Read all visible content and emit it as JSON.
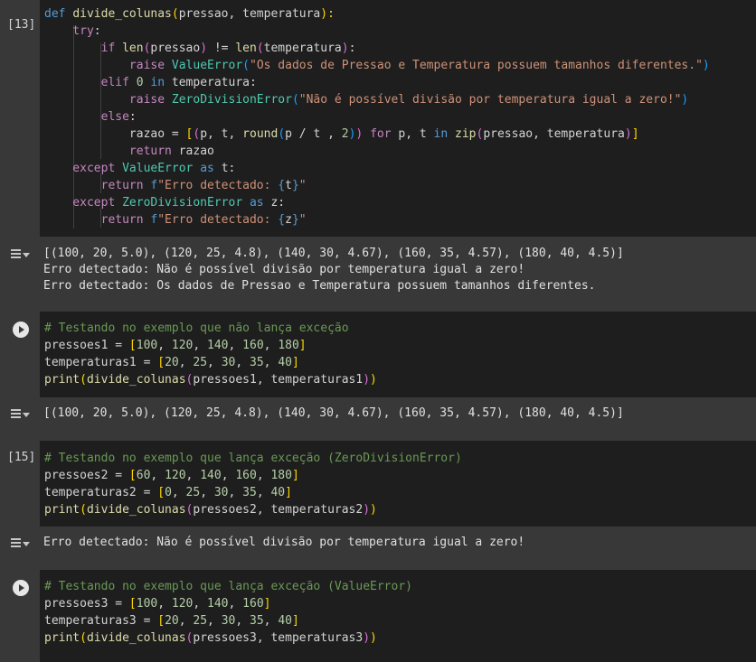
{
  "cell13": {
    "exec_count": "[13]",
    "lines": [
      [
        [
          "kw",
          "def "
        ],
        [
          "fn",
          "divide_colunas"
        ],
        [
          "br",
          "("
        ],
        [
          "var",
          "pressao, temperatura"
        ],
        [
          "br",
          "):"
        ]
      ],
      [
        [
          "ctl",
          "    try"
        ],
        [
          "var",
          ":"
        ]
      ],
      [
        [
          "ctl",
          "        if "
        ],
        [
          "fn",
          "len"
        ],
        [
          "br2",
          "("
        ],
        [
          "var",
          "pressao"
        ],
        [
          "br2",
          ")"
        ],
        [
          "var",
          " != "
        ],
        [
          "fn",
          "len"
        ],
        [
          "br2",
          "("
        ],
        [
          "var",
          "temperatura"
        ],
        [
          "br2",
          ")"
        ],
        [
          "var",
          ":"
        ]
      ],
      [
        [
          "ctl",
          "            raise "
        ],
        [
          "cls",
          "ValueError"
        ],
        [
          "br3",
          "("
        ],
        [
          "str",
          "\"Os dados de Pressao e Temperatura possuem tamanhos diferentes.\""
        ],
        [
          "br3",
          ")"
        ]
      ],
      [
        [
          "ctl",
          "        elif "
        ],
        [
          "num",
          "0"
        ],
        [
          "kw",
          " in "
        ],
        [
          "var",
          "temperatura:"
        ]
      ],
      [
        [
          "ctl",
          "            raise "
        ],
        [
          "cls",
          "ZeroDivisionError"
        ],
        [
          "br3",
          "("
        ],
        [
          "str",
          "\"Não é possível divisão por temperatura igual a zero!\""
        ],
        [
          "br3",
          ")"
        ]
      ],
      [
        [
          "ctl",
          "        else"
        ],
        [
          "var",
          ":"
        ]
      ],
      [
        [
          "var",
          "            razao = "
        ],
        [
          "br",
          "["
        ],
        [
          "br2",
          "("
        ],
        [
          "var",
          "p, t, "
        ],
        [
          "fn",
          "round"
        ],
        [
          "br3",
          "("
        ],
        [
          "var",
          "p / t , "
        ],
        [
          "num",
          "2"
        ],
        [
          "br3",
          ")"
        ],
        [
          "br2",
          ")"
        ],
        [
          "ctl",
          " for "
        ],
        [
          "var",
          "p, t "
        ],
        [
          "kw",
          "in "
        ],
        [
          "fn",
          "zip"
        ],
        [
          "br2",
          "("
        ],
        [
          "var",
          "pressao, temperatura"
        ],
        [
          "br2",
          ")"
        ],
        [
          "br",
          "]"
        ]
      ],
      [
        [
          "ctl",
          "            return "
        ],
        [
          "var",
          "razao"
        ]
      ],
      [
        [
          "ctl",
          "    except "
        ],
        [
          "cls",
          "ValueError"
        ],
        [
          "kw",
          " as "
        ],
        [
          "var",
          "t:"
        ]
      ],
      [
        [
          "ctl",
          "        return "
        ],
        [
          "kw",
          "f"
        ],
        [
          "str",
          "\"Erro detectado: "
        ],
        [
          "kw",
          "{"
        ],
        [
          "var",
          "t"
        ],
        [
          "kw",
          "}"
        ],
        [
          "str",
          "\""
        ]
      ],
      [
        [
          "ctl",
          "    except "
        ],
        [
          "cls",
          "ZeroDivisionError"
        ],
        [
          "kw",
          " as "
        ],
        [
          "var",
          "z:"
        ]
      ],
      [
        [
          "ctl",
          "        return "
        ],
        [
          "kw",
          "f"
        ],
        [
          "str",
          "\"Erro detectado: "
        ],
        [
          "kw",
          "{"
        ],
        [
          "var",
          "z"
        ],
        [
          "kw",
          "}"
        ],
        [
          "str",
          "\""
        ]
      ]
    ],
    "output": [
      "[(100, 20, 5.0), (120, 25, 4.8), (140, 30, 4.67), (160, 35, 4.57), (180, 40, 4.5)]",
      "Erro detectado: Não é possível divisão por temperatura igual a zero!",
      "Erro detectado: Os dados de Pressao e Temperatura possuem tamanhos diferentes."
    ]
  },
  "cell14": {
    "lines": [
      [
        [
          "cm",
          "# Testando no exemplo que não lança exceção"
        ]
      ],
      [
        [
          "var",
          "pressoes1 = "
        ],
        [
          "br",
          "["
        ],
        [
          "num",
          "100"
        ],
        [
          "var",
          ", "
        ],
        [
          "num",
          "120"
        ],
        [
          "var",
          ", "
        ],
        [
          "num",
          "140"
        ],
        [
          "var",
          ", "
        ],
        [
          "num",
          "160"
        ],
        [
          "var",
          ", "
        ],
        [
          "num",
          "180"
        ],
        [
          "br",
          "]"
        ]
      ],
      [
        [
          "var",
          "temperaturas1 = "
        ],
        [
          "br",
          "["
        ],
        [
          "num",
          "20"
        ],
        [
          "var",
          ", "
        ],
        [
          "num",
          "25"
        ],
        [
          "var",
          ", "
        ],
        [
          "num",
          "30"
        ],
        [
          "var",
          ", "
        ],
        [
          "num",
          "35"
        ],
        [
          "var",
          ", "
        ],
        [
          "num",
          "40"
        ],
        [
          "br",
          "]"
        ]
      ],
      [
        [
          "fn",
          "print"
        ],
        [
          "br",
          "("
        ],
        [
          "fn",
          "divide_colunas"
        ],
        [
          "br2",
          "("
        ],
        [
          "var",
          "pressoes1, temperaturas1"
        ],
        [
          "br2",
          ")"
        ],
        [
          "br",
          ")"
        ]
      ]
    ],
    "output": [
      "[(100, 20, 5.0), (120, 25, 4.8), (140, 30, 4.67), (160, 35, 4.57), (180, 40, 4.5)]"
    ]
  },
  "cell15": {
    "exec_count": "[15]",
    "lines": [
      [
        [
          "cm",
          "# Testando no exemplo que lança exceção (ZeroDivisionError)"
        ]
      ],
      [
        [
          "var",
          "pressoes2 = "
        ],
        [
          "br",
          "["
        ],
        [
          "num",
          "60"
        ],
        [
          "var",
          ", "
        ],
        [
          "num",
          "120"
        ],
        [
          "var",
          ", "
        ],
        [
          "num",
          "140"
        ],
        [
          "var",
          ", "
        ],
        [
          "num",
          "160"
        ],
        [
          "var",
          ", "
        ],
        [
          "num",
          "180"
        ],
        [
          "br",
          "]"
        ]
      ],
      [
        [
          "var",
          "temperaturas2 = "
        ],
        [
          "br",
          "["
        ],
        [
          "num",
          "0"
        ],
        [
          "var",
          ", "
        ],
        [
          "num",
          "25"
        ],
        [
          "var",
          ", "
        ],
        [
          "num",
          "30"
        ],
        [
          "var",
          ", "
        ],
        [
          "num",
          "35"
        ],
        [
          "var",
          ", "
        ],
        [
          "num",
          "40"
        ],
        [
          "br",
          "]"
        ]
      ],
      [
        [
          "fn",
          "print"
        ],
        [
          "br",
          "("
        ],
        [
          "fn",
          "divide_colunas"
        ],
        [
          "br2",
          "("
        ],
        [
          "var",
          "pressoes2, temperaturas2"
        ],
        [
          "br2",
          ")"
        ],
        [
          "br",
          ")"
        ]
      ]
    ],
    "output": [
      "Erro detectado: Não é possível divisão por temperatura igual a zero!"
    ]
  },
  "cell16": {
    "lines": [
      [
        [
          "cm",
          "# Testando no exemplo que lança exceção (ValueError)"
        ]
      ],
      [
        [
          "var",
          "pressoes3 = "
        ],
        [
          "br",
          "["
        ],
        [
          "num",
          "100"
        ],
        [
          "var",
          ", "
        ],
        [
          "num",
          "120"
        ],
        [
          "var",
          ", "
        ],
        [
          "num",
          "140"
        ],
        [
          "var",
          ", "
        ],
        [
          "num",
          "160"
        ],
        [
          "br",
          "]"
        ]
      ],
      [
        [
          "var",
          "temperaturas3 = "
        ],
        [
          "br",
          "["
        ],
        [
          "num",
          "20"
        ],
        [
          "var",
          ", "
        ],
        [
          "num",
          "25"
        ],
        [
          "var",
          ", "
        ],
        [
          "num",
          "30"
        ],
        [
          "var",
          ", "
        ],
        [
          "num",
          "35"
        ],
        [
          "var",
          ", "
        ],
        [
          "num",
          "40"
        ],
        [
          "br",
          "]"
        ]
      ],
      [
        [
          "fn",
          "print"
        ],
        [
          "br",
          "("
        ],
        [
          "fn",
          "divide_colunas"
        ],
        [
          "br2",
          "("
        ],
        [
          "var",
          "pressoes3, temperaturas3"
        ],
        [
          "br2",
          ")"
        ],
        [
          "br",
          ")"
        ]
      ]
    ]
  }
}
